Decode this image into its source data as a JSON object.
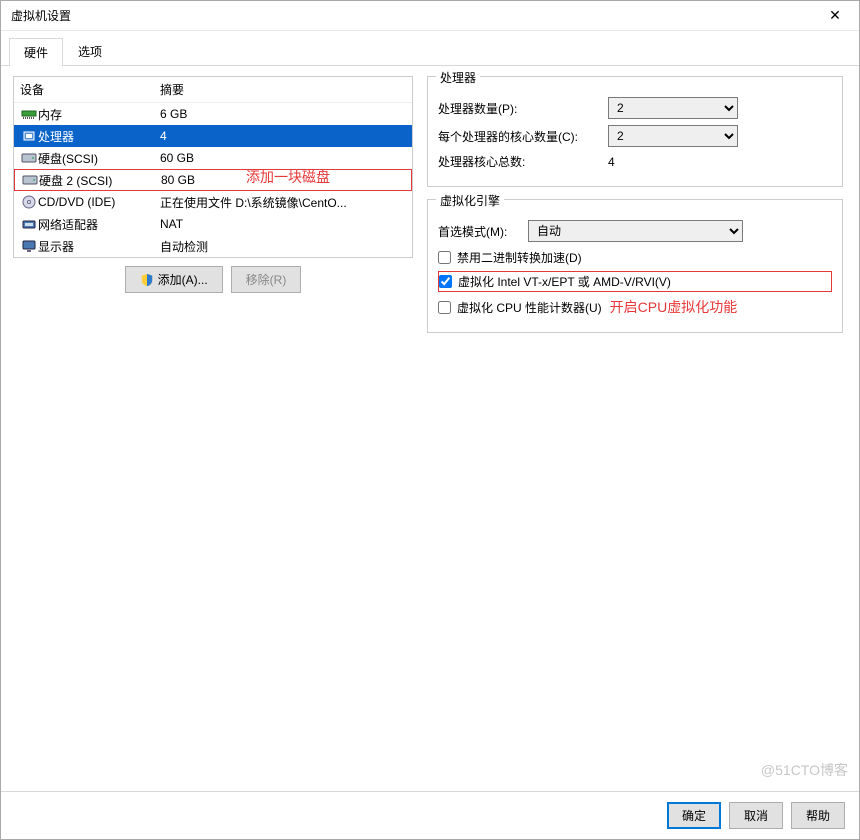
{
  "window": {
    "title": "虚拟机设置"
  },
  "tabs": {
    "hardware": "硬件",
    "options": "选项",
    "active": "hardware"
  },
  "device_list": {
    "col_device": "设备",
    "col_summary": "摘要",
    "rows": [
      {
        "icon": "memory",
        "name": "内存",
        "summary": "6 GB"
      },
      {
        "icon": "cpu",
        "name": "处理器",
        "summary": "4",
        "selected": true
      },
      {
        "icon": "disk",
        "name": "硬盘(SCSI)",
        "summary": "60 GB"
      },
      {
        "icon": "disk",
        "name": "硬盘 2 (SCSI)",
        "summary": "80 GB",
        "highlight": true
      },
      {
        "icon": "cd",
        "name": "CD/DVD (IDE)",
        "summary": "正在使用文件 D:\\系统镜像\\CentO..."
      },
      {
        "icon": "net",
        "name": "网络适配器",
        "summary": "NAT"
      },
      {
        "icon": "display",
        "name": "显示器",
        "summary": "自动检测"
      }
    ]
  },
  "annotations": {
    "add_disk": "添加一块磁盘",
    "enable_vt": "开启CPU虚拟化功能"
  },
  "buttons": {
    "add": "添加(A)...",
    "remove": "移除(R)",
    "ok": "确定",
    "cancel": "取消",
    "help": "帮助"
  },
  "processor": {
    "group_title": "处理器",
    "count_label": "处理器数量(P):",
    "count_value": "2",
    "cores_label": "每个处理器的核心数量(C):",
    "cores_value": "2",
    "total_label": "处理器核心总数:",
    "total_value": "4"
  },
  "virt_engine": {
    "group_title": "虚拟化引擎",
    "mode_label": "首选模式(M):",
    "mode_value": "自动",
    "cb_disable_binary": "禁用二进制转换加速(D)",
    "cb_vt": "虚拟化 Intel VT-x/EPT 或 AMD-V/RVI(V)",
    "cb_perf": "虚拟化 CPU 性能计数器(U)"
  },
  "watermark": "@51CTO博客"
}
